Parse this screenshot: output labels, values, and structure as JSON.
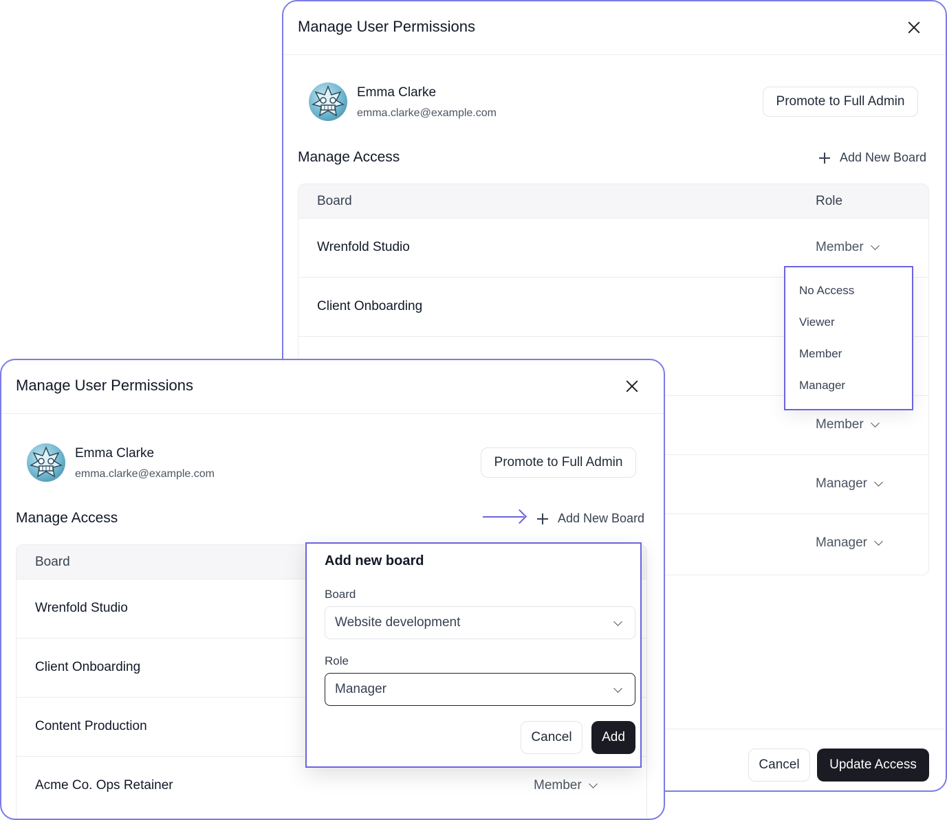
{
  "back_modal": {
    "title": "Manage User Permissions",
    "user": {
      "name": "Emma Clarke",
      "email": "emma.clarke@example.com"
    },
    "promote_label": "Promote to Full Admin",
    "section_title": "Manage Access",
    "add_board_label": "Add New Board",
    "table": {
      "headers": {
        "board": "Board",
        "role": "Role"
      },
      "rows": [
        {
          "board": "Wrenfold Studio",
          "role": "Member"
        },
        {
          "board": "Client Onboarding",
          "role": ""
        },
        {
          "board": "",
          "role": ""
        },
        {
          "board": "",
          "role": "Member"
        },
        {
          "board": "",
          "role": "Manager"
        },
        {
          "board": "",
          "role": "Manager"
        }
      ]
    },
    "role_dropdown": {
      "options": [
        "No Access",
        "Viewer",
        "Member",
        "Manager"
      ]
    },
    "footer": {
      "cancel_label": "Cancel",
      "update_label": "Update Access"
    }
  },
  "front_modal": {
    "title": "Manage User Permissions",
    "user": {
      "name": "Emma Clarke",
      "email": "emma.clarke@example.com"
    },
    "promote_label": "Promote to Full Admin",
    "section_title": "Manage Access",
    "add_board_label": "Add New Board",
    "table": {
      "headers": {
        "board": "Board"
      },
      "rows": [
        {
          "board": "Wrenfold Studio"
        },
        {
          "board": "Client Onboarding"
        },
        {
          "board": "Content Production"
        },
        {
          "board": "Acme Co. Ops Retainer",
          "role": "Member"
        }
      ]
    },
    "add_board_popover": {
      "title": "Add new board",
      "board_label": "Board",
      "board_value": "Website development",
      "role_label": "Role",
      "role_value": "Manager",
      "cancel_label": "Cancel",
      "add_label": "Add"
    }
  },
  "colors": {
    "accent": "#6b63e0",
    "dark_button": "#1a1b23",
    "modal_border": "#7b7be6"
  }
}
